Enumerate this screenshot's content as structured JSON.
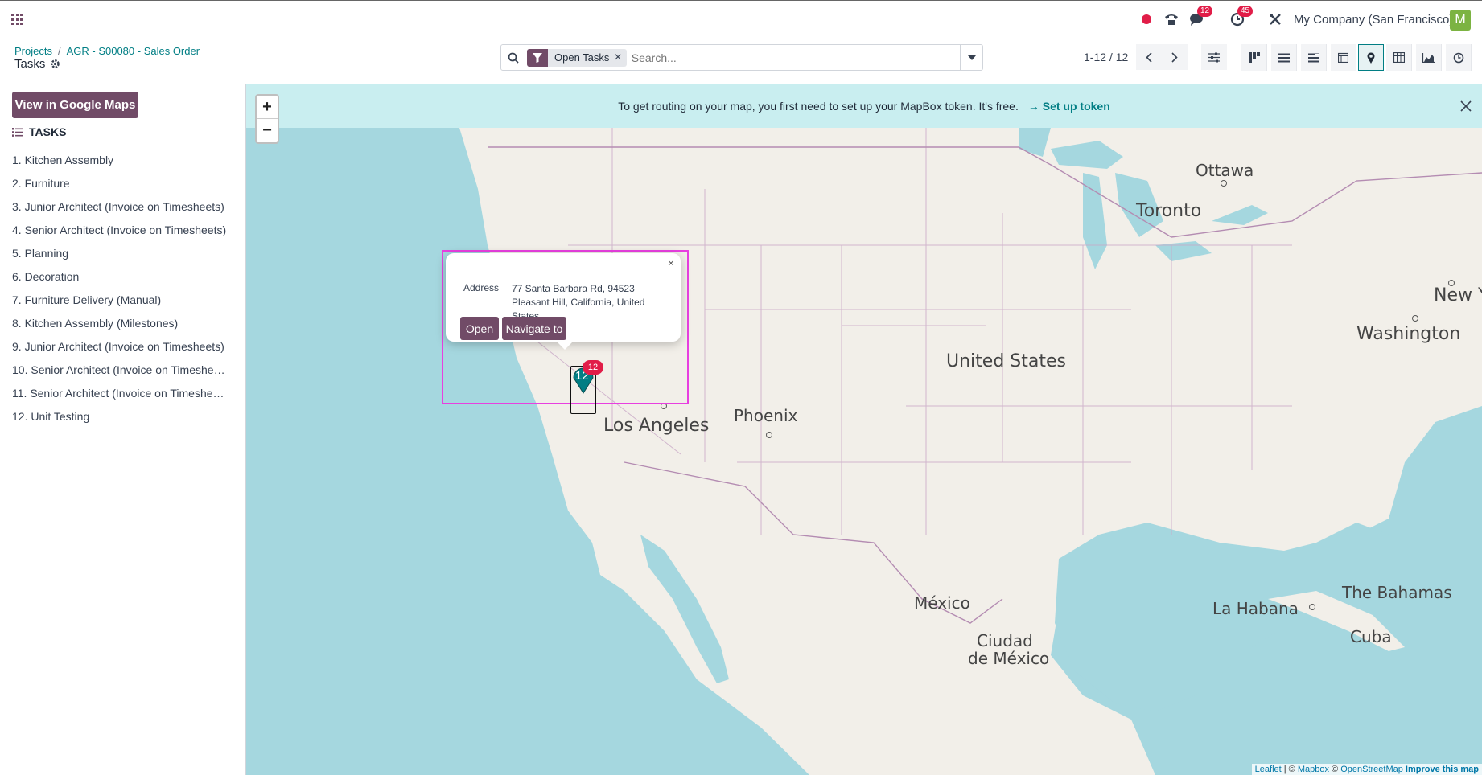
{
  "navbar": {
    "messages_count": "12",
    "activities_count": "45",
    "company": "My Company (San Francisco)",
    "avatar_letter": "M"
  },
  "breadcrumb": {
    "root": "Projects",
    "separator": "/",
    "parent": "AGR - S00080 - Sales Order"
  },
  "page_title": "Tasks",
  "search": {
    "facet": "Open Tasks",
    "placeholder": "Search..."
  },
  "pager": {
    "text": "1-12 / 12"
  },
  "sidebar": {
    "gmaps_button": "View in Google Maps",
    "heading": "TASKS",
    "tasks": [
      "1. Kitchen Assembly",
      "2. Furniture",
      "3. Junior Architect (Invoice on Timesheets)",
      "4. Senior Architect (Invoice on Timesheets)",
      "5. Planning",
      "6. Decoration",
      "7. Furniture Delivery (Manual)",
      "8. Kitchen Assembly (Milestones)",
      "9. Junior Architect (Invoice on Timesheets)",
      "10. Senior Architect (Invoice on Timeshe…",
      "11. Senior Architect (Invoice on Timeshe…",
      "12. Unit Testing"
    ]
  },
  "map": {
    "banner_text": "To get routing on your map, you first need to set up your MapBox token. It's free.",
    "banner_link": "Set up token",
    "zoom_in": "+",
    "zoom_out": "−",
    "labels": {
      "ottawa": "Ottawa",
      "toronto": "Toronto",
      "new_york": "New Yo",
      "washington": "Washington",
      "united_states": "United States",
      "phoenix": "Phoenix",
      "los_angeles": "Los Angeles",
      "mexico": "México",
      "la_habana": "La Habana",
      "bahamas": "The Bahamas",
      "cuba": "Cuba",
      "ciudad": "Ciudad",
      "de_mexico": "de México"
    },
    "popup": {
      "close": "×",
      "address_label": "Address",
      "address": "77 Santa Barbara Rd, 94523 Pleasant Hill, California, United States",
      "open_button": "Open",
      "navigate_button": "Navigate to"
    },
    "marker_count": "12",
    "marker_number": "12",
    "attribution": {
      "leaflet": "Leaflet",
      "sep": " | © ",
      "mapbox": "Mapbox",
      "osm_prefix": " © ",
      "osm": "OpenStreetMap",
      "improve": "Improve this map"
    }
  },
  "colors": {
    "brand": "#714b67",
    "accent": "#017e84",
    "badge": "#e11d48",
    "water": "#a5d7df",
    "land": "#f2efe9",
    "banner": "#c9eef0"
  }
}
